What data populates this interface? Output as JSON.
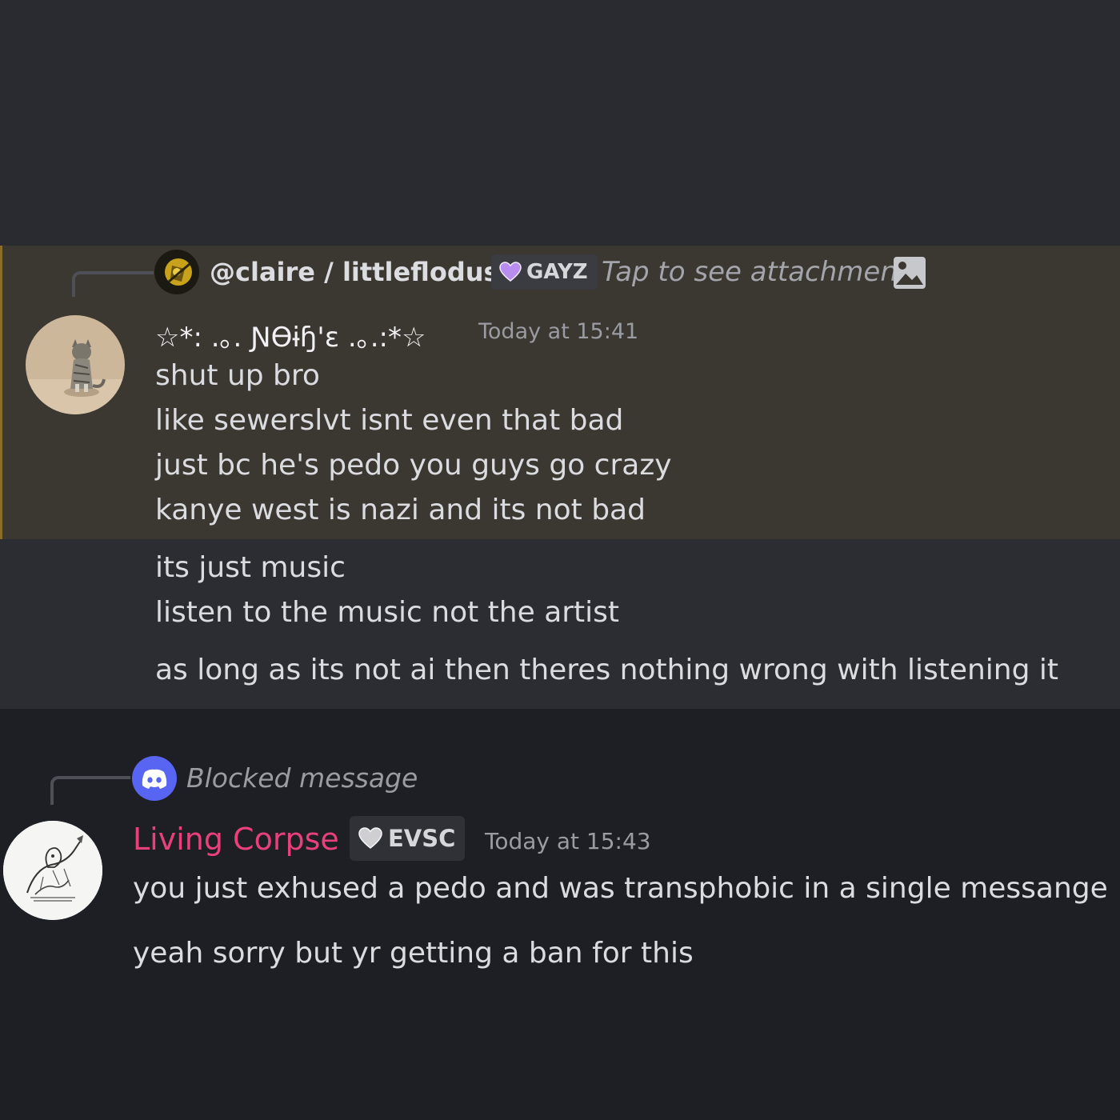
{
  "reply1": {
    "handle": "@claire / littleflodus",
    "tag": "GAYZ",
    "attachment_text": "Tap to see attachment"
  },
  "message1": {
    "author": "☆*: .｡. ƝѲɨɧ'ɛ .｡.:*☆",
    "timestamp": "Today at 15:41",
    "lines": [
      "shut up bro",
      "like sewerslvt isnt even that bad",
      "just bc he's pedo you guys go crazy",
      "kanye west is nazi and its not bad"
    ],
    "continuation": [
      "its just music",
      "listen to the music not the artist",
      "as long as its not ai then theres nothing wrong with listening it"
    ]
  },
  "reply2": {
    "text": "Blocked message"
  },
  "message2": {
    "author": "Living Corpse",
    "tag": "EVSC",
    "timestamp": "Today at 15:43",
    "lines": [
      "you just exhused a pedo and was transphobic in a single messange",
      "yeah sorry but yr getting a ban for this"
    ]
  },
  "colors": {
    "mention_highlight": "#3b3731",
    "mention_bar": "#8a6c2b",
    "author2_name": "#e8407a",
    "discord_blurple": "#5865f2",
    "tag_heart_gayz": "#b98cf0"
  },
  "icons": [
    "avatar-claire",
    "heart-icon",
    "image-icon",
    "cat-avatar",
    "discord-icon",
    "sketch-avatar"
  ]
}
